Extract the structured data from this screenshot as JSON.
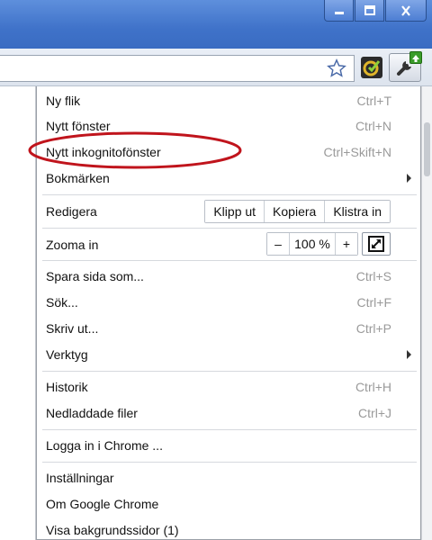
{
  "window": {
    "minimize_icon": "minimize-icon",
    "maximize_icon": "maximize-icon",
    "close_icon": "close-icon"
  },
  "toolbar": {
    "bookmark_icon": "star-icon",
    "extension_icon": "extension-icon",
    "menu_icon": "wrench-icon",
    "update_badge_color": "#3a9c2a"
  },
  "menu": {
    "new_tab": {
      "label": "Ny flik",
      "shortcut": "Ctrl+T"
    },
    "new_window": {
      "label": "Nytt fönster",
      "shortcut": "Ctrl+N"
    },
    "new_incognito": {
      "label": "Nytt inkognitofönster",
      "shortcut": "Ctrl+Skift+N"
    },
    "bookmarks": {
      "label": "Bokmärken"
    },
    "edit": {
      "label": "Redigera",
      "cut": "Klipp ut",
      "copy": "Kopiera",
      "paste": "Klistra in"
    },
    "zoom": {
      "label": "Zooma in",
      "minus": "–",
      "value": "100 %",
      "plus": "+"
    },
    "save_page": {
      "label": "Spara sida som...",
      "shortcut": "Ctrl+S"
    },
    "find": {
      "label": "Sök...",
      "shortcut": "Ctrl+F"
    },
    "print": {
      "label": "Skriv ut...",
      "shortcut": "Ctrl+P"
    },
    "tools": {
      "label": "Verktyg"
    },
    "history": {
      "label": "Historik",
      "shortcut": "Ctrl+H"
    },
    "downloads": {
      "label": "Nedladdade filer",
      "shortcut": "Ctrl+J"
    },
    "sign_in": {
      "label": "Logga in i Chrome ..."
    },
    "settings": {
      "label": "Inställningar"
    },
    "about": {
      "label": "Om Google Chrome"
    },
    "background_pages": {
      "label": "Visa bakgrundssidor (1)"
    }
  },
  "colors": {
    "titlebar": "#3f72c9",
    "highlight_ellipse": "#c0141c",
    "shortcut_text": "#9a9a9a"
  }
}
